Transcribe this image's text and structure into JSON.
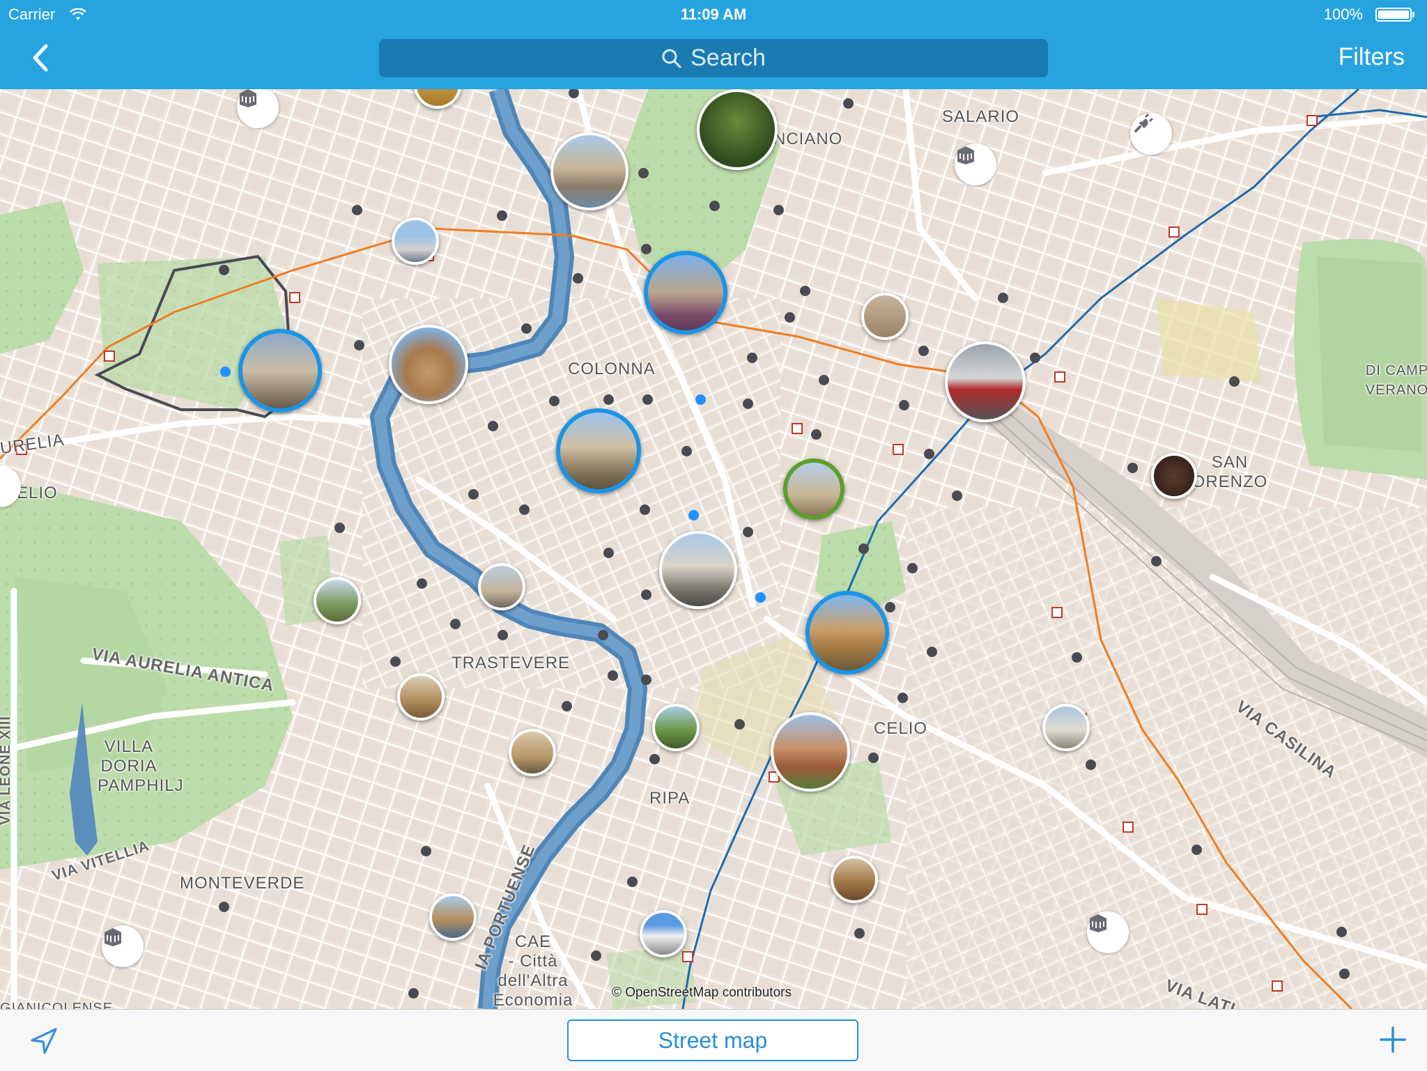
{
  "status_bar": {
    "carrier": "Carrier",
    "time": "11:09 AM",
    "battery": "100%"
  },
  "nav": {
    "search_placeholder": "Search",
    "filters_label": "Filters"
  },
  "map": {
    "labels": {
      "salario": "SALARIO",
      "nciano": "NCIANO",
      "colonna": "COLONNA",
      "urelia": "URELIA",
      "elio": "ELIO",
      "trastevere": "TRASTEVERE",
      "via_aurelia_antica": "VIA AURELIA ANTICA",
      "villa_doria": "VILLA\nDORIA\nPAMPHILJ",
      "via_leone": "VIA LEONE XIII",
      "via_vitellia": "VIA VITELLIA",
      "monteverde": "MONTEVERDE",
      "via_portuense": "IA PORTUENSE",
      "cae": "CAE\n- Città\ndell'Altra\nEconomia",
      "ripa": "RIPA",
      "celio": "CELIO",
      "san_lorenzo": "SAN\nORENZO",
      "verano": "DI CAMP\nVERANO",
      "via_casilina": "VIA CASILINA",
      "via_latina": "VIA LATI",
      "gianicolense": "GIANICOLENSE"
    },
    "attribution": "© OpenStreetMap contributors"
  },
  "toolbar": {
    "map_type_label": "Street map"
  },
  "colors": {
    "accent": "#27a3e0",
    "selected": "#1a94e6",
    "green_marker": "#5aa02c",
    "metro_orange": "#f07d1e",
    "metro_blue": "#1d6ab0"
  }
}
